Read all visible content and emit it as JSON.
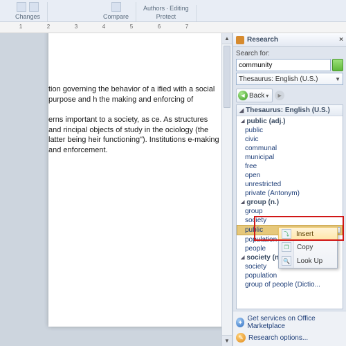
{
  "ribbon": {
    "groups": [
      {
        "label": "Changes"
      },
      {
        "label": "Compare"
      },
      {
        "label": "Protect",
        "sub1": "Authors",
        "sub2": "Editing"
      }
    ]
  },
  "ruler": {
    "marks": [
      "1",
      "2",
      "3",
      "4",
      "5",
      "6",
      "7"
    ]
  },
  "document": {
    "para1": "tion governing the behavior of a ified with a social purpose and h the making and enforcing of",
    "para2": "erns important to a society, as ce. As structures and rincipal objects of study in the ociology (the latter being heir functioning\"). Institutions e-making and enforcement."
  },
  "pane": {
    "title": "Research",
    "search_label": "Search for:",
    "search_value": "community",
    "source_label": "Thesaurus: English (U.S.)",
    "back_label": "Back",
    "results_title": "Thesaurus: English (U.S.)",
    "tree": {
      "g1": "public (adj.)",
      "g1items": [
        "public",
        "civic",
        "communal",
        "municipal",
        "free",
        "open",
        "unrestricted",
        "private (Antonym)"
      ],
      "g2": "group (n.)",
      "g2items": [
        "group",
        "society",
        "public",
        "population",
        "people"
      ],
      "g3": "society (n.)",
      "g3items": [
        "society",
        "population",
        "group of people (Dictio..."
      ]
    },
    "selected_word": "public",
    "context": {
      "insert": "Insert",
      "copy": "Copy",
      "lookup": "Look Up"
    },
    "footer1": "Get services on Office Marketplace",
    "footer2": "Research options..."
  }
}
